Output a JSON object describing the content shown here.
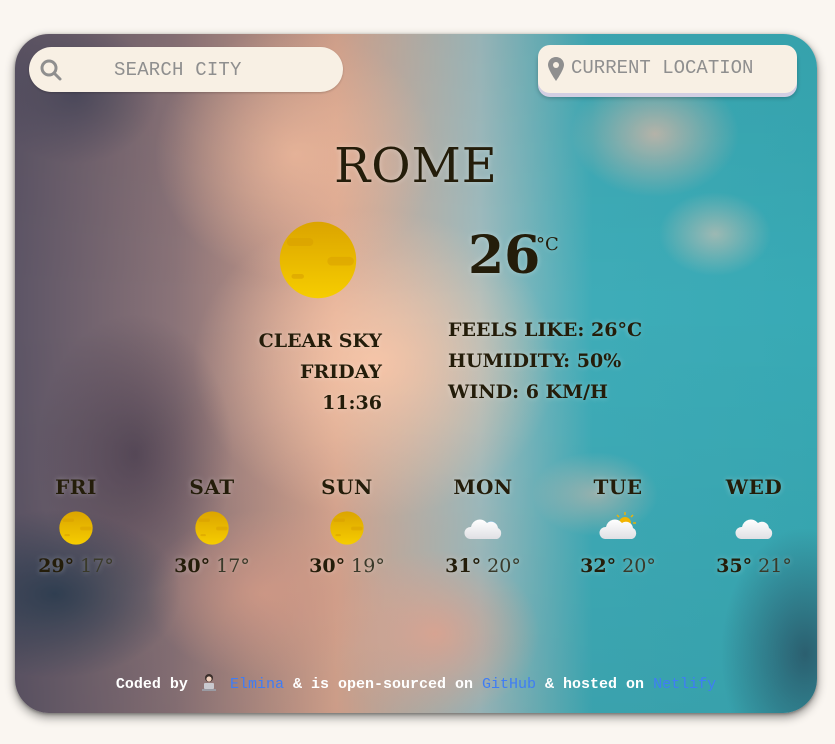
{
  "search": {
    "placeholder": "SEARCH CITY",
    "icon": "search-icon"
  },
  "location_button": {
    "label": "CURRENT LOCATION",
    "icon": "map-pin-icon"
  },
  "current": {
    "city": "ROME",
    "temperature": "26",
    "unit": "°C",
    "condition": "CLEAR SKY",
    "datetime": "FRIDAY 11:36",
    "icon": "sun-icon",
    "details": {
      "feels_like": "FEELS LIKE: 26°C",
      "humidity": "HUMIDITY: 50%",
      "wind": "WIND: 6 KM/H"
    }
  },
  "forecast": [
    {
      "day": "FRI",
      "max": "29°",
      "min": "17°",
      "icon": "sun-icon"
    },
    {
      "day": "SAT",
      "max": "30°",
      "min": "17°",
      "icon": "sun-icon"
    },
    {
      "day": "SUN",
      "max": "30°",
      "min": "19°",
      "icon": "sun-icon"
    },
    {
      "day": "MON",
      "max": "31°",
      "min": "20°",
      "icon": "cloud-icon"
    },
    {
      "day": "TUE",
      "max": "32°",
      "min": "20°",
      "icon": "partly-cloudy-icon"
    },
    {
      "day": "WED",
      "max": "35°",
      "min": "21°",
      "icon": "cloud-icon"
    }
  ],
  "footer": {
    "coded_by": "Coded by",
    "author": "Elmina",
    "middle": "& is open-sourced on",
    "github": "GitHub",
    "hosted": "& hosted on",
    "netlify": "Netlify"
  },
  "colors": {
    "text": "#241d0a",
    "input_bg": "#f8f0e4",
    "link": "#3f7df5",
    "sun": "#f2c200"
  }
}
